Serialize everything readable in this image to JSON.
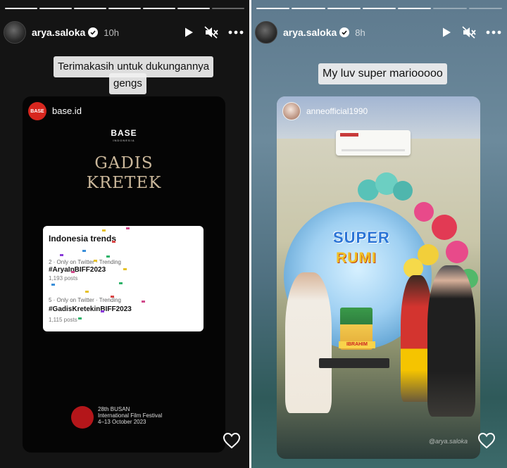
{
  "left_story": {
    "username": "arya.saloka",
    "time": "10h",
    "caption_line1": "Terimakasih untuk dukungannya",
    "caption_line2": "gengs",
    "card": {
      "account_logo": "BASE",
      "account_handle": "base.id",
      "wordmark": "BASE",
      "wordmark_sub": "INDONESIA",
      "title_line1": "GADIS",
      "title_line2": "KRETEK",
      "trends": {
        "heading": "Indonesia trends",
        "items": [
          {
            "meta": "2 · Only on Twitter · Trending",
            "tag": "#AryaInBIFF2023",
            "count": "1,193 posts"
          },
          {
            "meta": "5 · Only on Twitter · Trending",
            "tag": "#GadisKretekinBIFF2023",
            "count": "1,115 posts"
          }
        ]
      },
      "festival_line1": "28th BUSAN",
      "festival_line2": "International Film Festival",
      "festival_line3": "4–13 October 2023"
    }
  },
  "right_story": {
    "username": "arya.saloka",
    "time": "8h",
    "caption": "My luv super mariooooo",
    "repost": {
      "handle": "anneofficial1990",
      "banner_line1": "SUPER",
      "banner_line2": "RUMI",
      "cake_label": "IBRAHIM",
      "watermark": "@arya.saloka"
    }
  },
  "icons": {
    "play": "play-icon",
    "mute": "speaker-muted-icon",
    "more": "more-icon",
    "heart": "heart-icon",
    "verified": "verified-badge-icon"
  },
  "colors": {
    "left_bg": "#141414",
    "base_red": "#d7261e",
    "title_gold": "#cbb89b"
  }
}
